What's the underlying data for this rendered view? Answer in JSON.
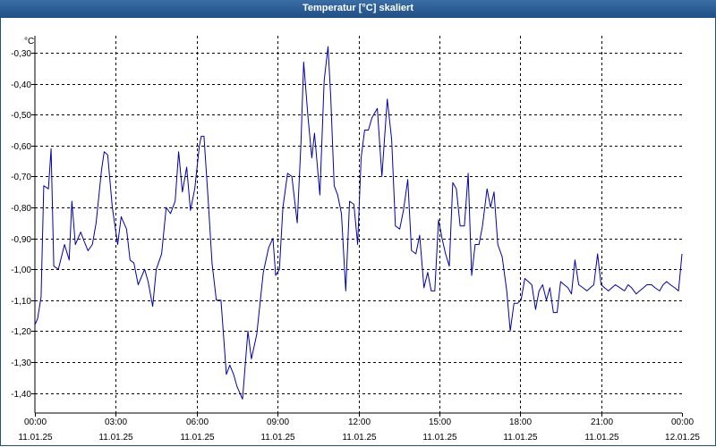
{
  "window": {
    "title": "Temperatur [°C] skaliert"
  },
  "chart_data": {
    "type": "line",
    "title": "Temperatur [°C] skaliert",
    "ylabel": "°C",
    "xlabel": "",
    "ylim": [
      -1.465,
      -0.245
    ],
    "xlim": [
      0,
      24
    ],
    "grid": true,
    "y_ticks": [
      -1.4,
      -1.3,
      -1.2,
      -1.1,
      -1.0,
      -0.9,
      -0.8,
      -0.7,
      -0.6,
      -0.5,
      -0.4,
      -0.3
    ],
    "y_tick_labels": [
      "-1,40",
      "-1,30",
      "-1,20",
      "-1,10",
      "-1,00",
      "-0,90",
      "-0,80",
      "-0,70",
      "-0,60",
      "-0,50",
      "-0,40",
      "-0,30"
    ],
    "x_ticks": [
      {
        "time": "00:00",
        "date": "11.01.25",
        "hour": 0
      },
      {
        "time": "03:00",
        "date": "11.01.25",
        "hour": 3
      },
      {
        "time": "06:00",
        "date": "11.01.25",
        "hour": 6
      },
      {
        "time": "09:00",
        "date": "11.01.25",
        "hour": 9
      },
      {
        "time": "12:00",
        "date": "11.01.25",
        "hour": 12
      },
      {
        "time": "15:00",
        "date": "11.01.25",
        "hour": 15
      },
      {
        "time": "18:00",
        "date": "11.01.25",
        "hour": 18
      },
      {
        "time": "21:00",
        "date": "11.01.25",
        "hour": 21
      },
      {
        "time": "00:00",
        "date": "12.01.25",
        "hour": 24
      }
    ],
    "series": [
      {
        "color": "#0000b0",
        "x": [
          0.0,
          0.1,
          0.23,
          0.33,
          0.5,
          0.6,
          0.7,
          0.87,
          1.1,
          1.27,
          1.37,
          1.5,
          1.7,
          1.83,
          1.97,
          2.13,
          2.27,
          2.47,
          2.57,
          2.7,
          2.87,
          3.07,
          3.2,
          3.4,
          3.53,
          3.67,
          3.83,
          4.07,
          4.2,
          4.37,
          4.5,
          4.7,
          4.87,
          5.03,
          5.2,
          5.33,
          5.47,
          5.63,
          5.77,
          5.93,
          6.1,
          6.17,
          6.27,
          6.43,
          6.57,
          6.73,
          6.9,
          7.1,
          7.23,
          7.37,
          7.5,
          7.7,
          7.9,
          8.03,
          8.23,
          8.47,
          8.67,
          8.83,
          8.93,
          9.07,
          9.2,
          9.37,
          9.53,
          9.73,
          9.87,
          9.97,
          10.13,
          10.27,
          10.37,
          10.57,
          10.73,
          10.87,
          10.97,
          11.1,
          11.23,
          11.37,
          11.53,
          11.67,
          11.83,
          11.97,
          12.1,
          12.23,
          12.37,
          12.5,
          12.7,
          12.87,
          13.07,
          13.23,
          13.37,
          13.53,
          13.67,
          13.83,
          13.97,
          14.13,
          14.27,
          14.43,
          14.57,
          14.7,
          14.83,
          14.97,
          15.1,
          15.23,
          15.37,
          15.5,
          15.63,
          15.77,
          15.93,
          16.07,
          16.2,
          16.33,
          16.47,
          16.6,
          16.77,
          16.9,
          17.03,
          17.17,
          17.33,
          17.5,
          17.63,
          17.77,
          17.9,
          18.03,
          18.17,
          18.3,
          18.43,
          18.57,
          18.7,
          18.83,
          18.97,
          19.1,
          19.23,
          19.37,
          19.5,
          19.63,
          19.77,
          19.9,
          20.03,
          20.17,
          20.33,
          20.47,
          20.6,
          20.73,
          20.87,
          21.0,
          21.13,
          21.27,
          21.4,
          21.53,
          21.7,
          21.87,
          22.0,
          22.13,
          22.3,
          22.43,
          22.57,
          22.7,
          22.87,
          23.0,
          23.17,
          23.3,
          23.43,
          23.57,
          23.73,
          23.87,
          24.0
        ],
        "y": [
          -1.18,
          -1.16,
          -1.09,
          -0.73,
          -0.74,
          -0.61,
          -0.99,
          -1.0,
          -0.92,
          -0.97,
          -0.78,
          -0.92,
          -0.88,
          -0.91,
          -0.94,
          -0.92,
          -0.85,
          -0.68,
          -0.62,
          -0.63,
          -0.8,
          -0.92,
          -0.83,
          -0.87,
          -0.97,
          -0.98,
          -1.05,
          -1.0,
          -1.04,
          -1.12,
          -1.0,
          -0.95,
          -0.8,
          -0.82,
          -0.78,
          -0.62,
          -0.75,
          -0.67,
          -0.81,
          -0.74,
          -0.6,
          -0.57,
          -0.57,
          -0.78,
          -0.98,
          -1.1,
          -1.1,
          -1.34,
          -1.31,
          -1.34,
          -1.38,
          -1.42,
          -1.2,
          -1.29,
          -1.21,
          -1.01,
          -0.93,
          -0.9,
          -1.02,
          -1.0,
          -0.8,
          -0.69,
          -0.7,
          -0.85,
          -0.59,
          -0.33,
          -0.51,
          -0.64,
          -0.56,
          -0.76,
          -0.39,
          -0.28,
          -0.44,
          -0.73,
          -0.76,
          -0.82,
          -1.07,
          -0.78,
          -0.79,
          -0.92,
          -0.64,
          -0.55,
          -0.55,
          -0.51,
          -0.48,
          -0.7,
          -0.45,
          -0.58,
          -0.86,
          -0.87,
          -0.81,
          -0.71,
          -0.94,
          -0.95,
          -0.89,
          -1.06,
          -1.01,
          -1.07,
          -1.07,
          -0.84,
          -0.9,
          -0.95,
          -0.99,
          -0.72,
          -0.74,
          -0.86,
          -0.86,
          -0.69,
          -1.02,
          -0.92,
          -0.92,
          -0.86,
          -0.74,
          -0.8,
          -0.75,
          -0.92,
          -0.96,
          -1.07,
          -1.2,
          -1.11,
          -1.11,
          -1.1,
          -1.03,
          -1.04,
          -1.05,
          -1.13,
          -1.07,
          -1.05,
          -1.1,
          -1.06,
          -1.14,
          -1.14,
          -1.04,
          -1.05,
          -1.06,
          -1.08,
          -0.97,
          -1.05,
          -1.06,
          -1.07,
          -1.06,
          -1.05,
          -0.95,
          -1.05,
          -1.06,
          -1.07,
          -1.06,
          -1.05,
          -1.06,
          -1.07,
          -1.05,
          -1.06,
          -1.08,
          -1.07,
          -1.06,
          -1.05,
          -1.05,
          -1.06,
          -1.07,
          -1.05,
          -1.04,
          -1.05,
          -1.06,
          -1.07,
          -0.95
        ]
      }
    ]
  }
}
